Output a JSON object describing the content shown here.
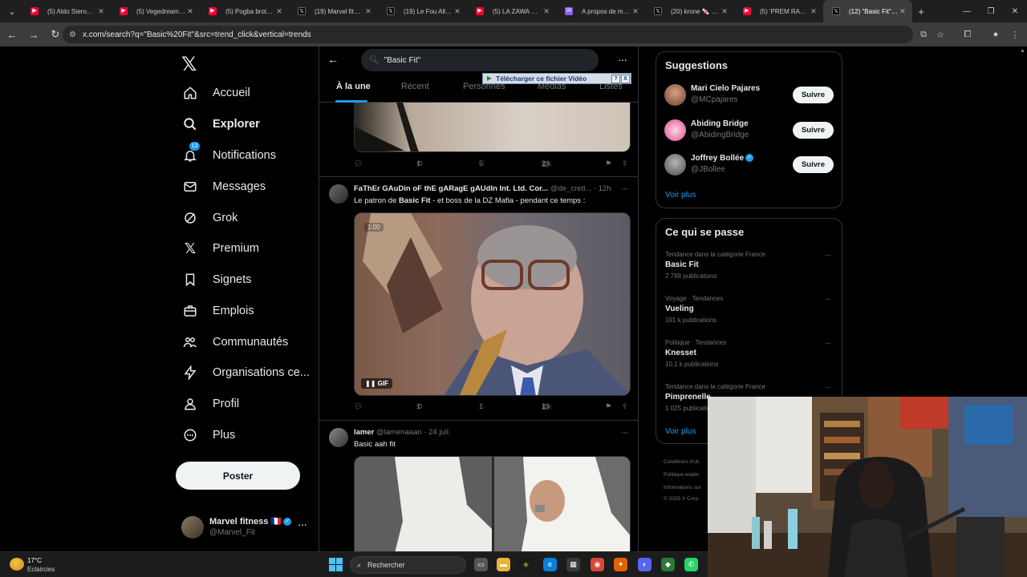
{
  "browser": {
    "tabs": [
      {
        "label": "(5) Aldo Sterone -",
        "favicon": "youtube-icon"
      },
      {
        "label": "(5) Vegedream, D",
        "favicon": "youtube-icon"
      },
      {
        "label": "(5) Pogba brother",
        "favicon": "youtube-icon"
      },
      {
        "label": "(19) Marvel fitnes",
        "favicon": "x-icon"
      },
      {
        "label": "(19) Le Fou Allié (",
        "favicon": "x-icon"
      },
      {
        "label": "(5) LA ZAWA PRO",
        "favicon": "youtube-icon"
      },
      {
        "label": "A propos de ma v",
        "favicon": "wiki-icon"
      },
      {
        "label": "(20) krone 🍬 sur",
        "favicon": "x-icon"
      },
      {
        "label": "(5) 'PREM RATAN",
        "favicon": "youtube-icon"
      },
      {
        "label": "(12) \"Basic Fit\" - R",
        "favicon": "x-icon",
        "active": true
      }
    ],
    "url": "x.com/search?q=\"Basic%20Fit\"&src=trend_click&vertical=trends"
  },
  "nav": {
    "items": [
      {
        "label": "Accueil",
        "icon": "home-icon"
      },
      {
        "label": "Explorer",
        "icon": "search-icon",
        "active": true
      },
      {
        "label": "Notifications",
        "icon": "bell-icon",
        "badge": "12"
      },
      {
        "label": "Messages",
        "icon": "mail-icon"
      },
      {
        "label": "Grok",
        "icon": "grok-icon"
      },
      {
        "label": "Premium",
        "icon": "x-icon"
      },
      {
        "label": "Signets",
        "icon": "bookmark-icon"
      },
      {
        "label": "Emplois",
        "icon": "briefcase-icon"
      },
      {
        "label": "Communautés",
        "icon": "people-icon"
      },
      {
        "label": "Organisations ce...",
        "icon": "lightning-icon"
      },
      {
        "label": "Profil",
        "icon": "person-icon"
      },
      {
        "label": "Plus",
        "icon": "more-circle-icon"
      }
    ],
    "post_label": "Poster",
    "account": {
      "name": "Marvel fitness 🇫🇷",
      "handle": "@Marvel_Fit"
    }
  },
  "search": {
    "query": "\"Basic Fit\"",
    "tabs": [
      "À la une",
      "Récent",
      "Personnes",
      "Médias",
      "Listes"
    ],
    "active_tab": "À la une"
  },
  "ad_overlay": {
    "label": "Télécharger ce fichier Vidéo",
    "help": "?",
    "close": "X"
  },
  "tweets": [
    {
      "actions": {
        "replies": "",
        "reposts": "1",
        "likes": "5",
        "views": "2 k"
      }
    },
    {
      "author": "FaThEr GAuDin oF thE gARagE gAUdIn Int. Ltd. Cor...",
      "handle": "@de_cretl...",
      "time": "12h",
      "text_before": "Le patron de ",
      "text_bold": "Basic Fit",
      "text_after": " - et boss de la DZ Mafia - pendant ce temps :",
      "media_time": "1:00",
      "media_badge": "GIF",
      "actions": {
        "replies": "",
        "reposts": "1",
        "likes": "1",
        "views": "1 k"
      }
    },
    {
      "author": "lamer",
      "handle": "@lamenaaan",
      "time": "24 juil.",
      "text": "Basic aah fit"
    }
  ],
  "suggestions": {
    "title": "Suggestions",
    "items": [
      {
        "name": "Mari Cielo Pajares",
        "handle": "@MCpajares",
        "verified": false
      },
      {
        "name": "Abiding Bridge",
        "handle": "@AbidingBridge",
        "verified": false
      },
      {
        "name": "Joffrey Bollée",
        "handle": "@JBollee",
        "verified": true
      }
    ],
    "follow_label": "Suivre",
    "show_more": "Voir plus"
  },
  "trends": {
    "title": "Ce qui se passe",
    "items": [
      {
        "context": "Tendance dans la catégorie France",
        "title": "Basic Fit",
        "count": "2 788 publications"
      },
      {
        "context": "Voyage · Tendances",
        "title": "Vueling",
        "count": "191 k publications"
      },
      {
        "context": "Politique · Tendances",
        "title": "Knesset",
        "count": "10,1 k publications"
      },
      {
        "context": "Tendance dans la catégorie France",
        "title": "Pimprenelle",
        "count": "1 025 publications"
      }
    ],
    "show_more": "Voir plus"
  },
  "footer": {
    "links": [
      "Conditions d'uti",
      "Politique relativ",
      "Informations sur",
      "© 2025 X Corp."
    ]
  },
  "taskbar": {
    "weather_temp": "17°C",
    "weather_desc": "Eclaircies",
    "search_label": "Rechercher"
  },
  "colors": {
    "accent": "#1d9bf0",
    "background": "#000000",
    "border": "#2f3336",
    "muted": "#71767b"
  }
}
